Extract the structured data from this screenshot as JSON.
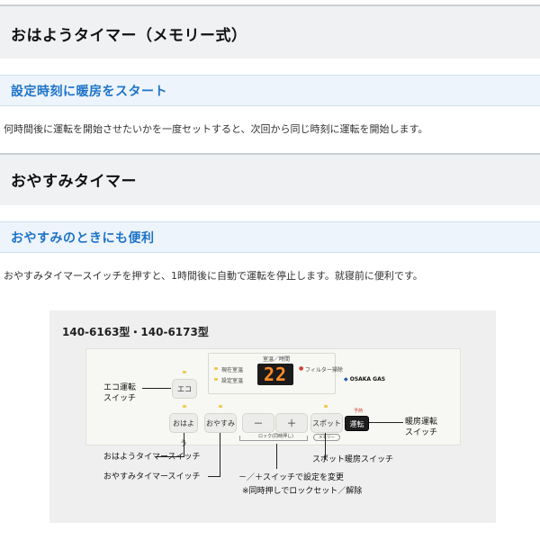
{
  "heading1": "おはようタイマー（メモリー式）",
  "subheading1": "設定時刻に暖房をスタート",
  "paragraph1": "何時間後に運転を開始させたいかを一度セットすると、次回から同じ時刻に運転を開始します。",
  "heading2": "おやすみタイマー",
  "subheading2": "おやすみのときにも便利",
  "paragraph2": "おやすみタイマースイッチを押すと、1時間後に自動で運転を停止します。就寝前に便利です。",
  "figure": {
    "model": "140-6163型・140-6173型",
    "panel": {
      "eco_button": "エコ",
      "ohayo_button": "おはよう",
      "oyasumi_button": "おやすみ",
      "minus_button": "－",
      "plus_button": "＋",
      "spot_button": "スポット",
      "unten_button": "運転",
      "display_value": "22",
      "display_caption": "室温／時間",
      "current_temp_label": "現在室温",
      "set_temp_label": "設定室温",
      "filter_label": "フィルター掃除",
      "lock_caption": "ロック(同時押し)",
      "memory_caption": "メモリー",
      "logo_text": "OSAKA GAS",
      "indicator_red": "予熱"
    },
    "annotations": {
      "eco_switch": "エコ運転\nスイッチ",
      "ohayo_switch": "おはようタイマースイッチ",
      "oyasumi_switch": "おやすみタイマースイッチ",
      "plusminus": "－／＋スイッチで設定を変更",
      "lock_note": "※同時押しでロックセット／解除",
      "spot_switch": "スポット暖房スイッチ",
      "unten_switch": "暖房運転\nスイッチ"
    }
  }
}
